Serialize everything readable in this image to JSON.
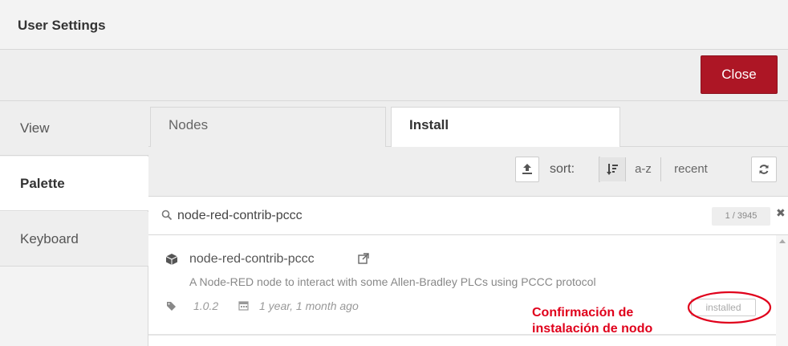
{
  "dialog": {
    "title": "User Settings",
    "close_label": "Close",
    "accent_color": "#ad1625"
  },
  "sidebar": {
    "items": [
      {
        "label": "View",
        "active": false
      },
      {
        "label": "Palette",
        "active": true
      },
      {
        "label": "Keyboard",
        "active": false
      }
    ]
  },
  "tabs": [
    {
      "label": "Nodes",
      "active": false
    },
    {
      "label": "Install",
      "active": true
    }
  ],
  "toolbar": {
    "upload_icon": "upload-icon",
    "sort_label": "sort:",
    "sort_options": [
      "a-z",
      "recent"
    ],
    "sort_active": "relevance",
    "refresh_icon": "refresh-icon"
  },
  "search": {
    "value": "node-red-contrib-pccc",
    "count": "1 / 3945"
  },
  "results": [
    {
      "name": "node-red-contrib-pccc",
      "description": "A Node-RED node to interact with some Allen-Bradley PLCs using PCCC protocol",
      "version": "1.0.2",
      "updated": "1 year, 1 month ago",
      "status": "installed"
    }
  ],
  "annotation": {
    "line1": "Confirmación de",
    "line2": "instalación de nodo",
    "color": "#e0001b"
  }
}
